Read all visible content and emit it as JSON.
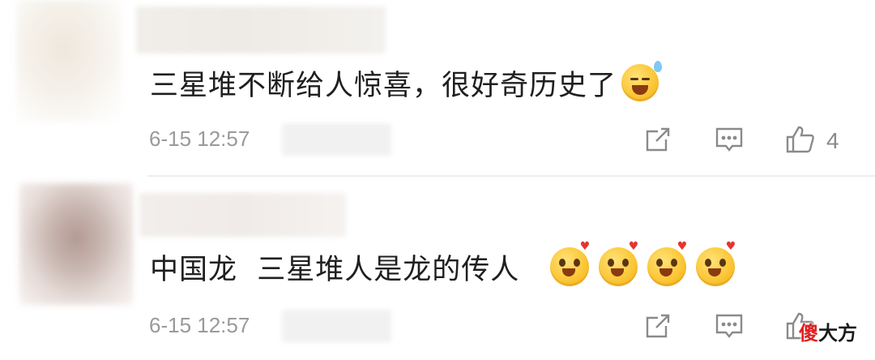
{
  "comments": [
    {
      "text": "三星堆不断给人惊喜，很好奇历史了",
      "emojis": [
        "laugh-tears"
      ],
      "time": "6-15 12:57",
      "like_count": "4"
    },
    {
      "text": "中国龙  三星堆人是龙的传人",
      "emojis": [
        "love-eyes",
        "love-eyes",
        "love-eyes",
        "love-eyes"
      ],
      "time": "6-15 12:57",
      "like_count": ""
    }
  ],
  "watermark": {
    "part1": "傻",
    "part2": "大方"
  },
  "colors": {
    "meta_text": "#9a9a9a",
    "icon": "#8a8a8a",
    "watermark_red": "#e02020"
  }
}
